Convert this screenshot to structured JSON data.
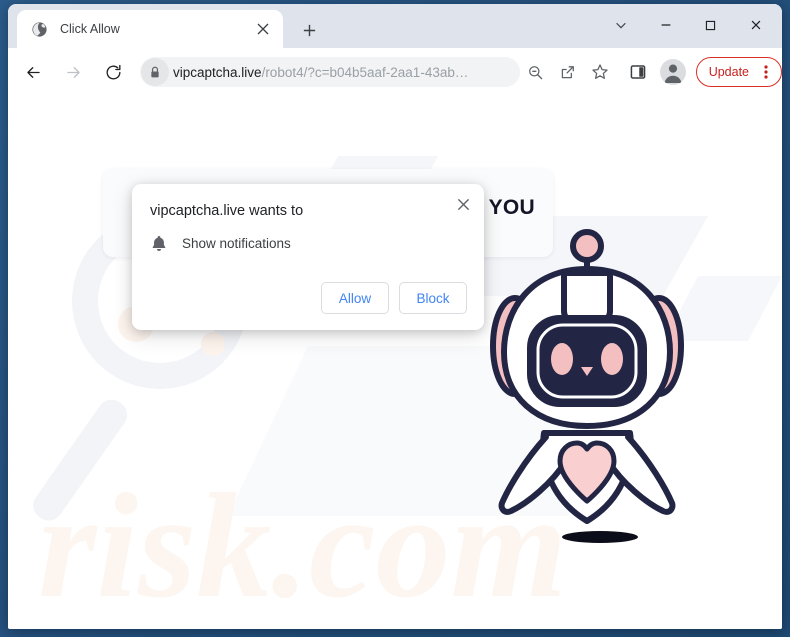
{
  "window": {
    "controls": {
      "tab_search": "tab-search-chevron",
      "minimize": "minimize",
      "maximize": "maximize",
      "close": "close"
    }
  },
  "tabstrip": {
    "tabs": [
      {
        "title": "Click Allow",
        "favicon": "globe-icon",
        "close": "close-icon"
      }
    ],
    "new_tab": "+"
  },
  "toolbar": {
    "back": "back-arrow-icon",
    "forward": "forward-arrow-icon",
    "reload": "reload-icon",
    "site_lock": "lock-icon",
    "url_prefix": "vipcaptcha.live",
    "url_suffix": "/robot4/?c=b04b5aaf-2aa1-43ab…",
    "url_full": "vipcaptcha.live/robot4/?c=b04b5aaf-2aa1-43ab…",
    "zoom_icon": "zoom-out-icon",
    "share_icon": "share-icon",
    "bookmark_icon": "star-icon",
    "side_panel_icon": "side-panel-icon",
    "profile_icon": "profile-avatar-icon",
    "update_label": "Update",
    "menu_icon": "three-dot-menu-icon"
  },
  "page": {
    "watermark": "PCrisk.com",
    "bubble_text": "YOU",
    "robot": "robot-mascot-illustration"
  },
  "dialog": {
    "title": "vipcaptcha.live wants to",
    "permission": "Show notifications",
    "permission_icon": "bell-icon",
    "close": "close-icon",
    "allow_label": "Allow",
    "block_label": "Block"
  },
  "colors": {
    "accent_blue": "#4285f4",
    "update_red": "#c5221f",
    "robot_navy": "#232544",
    "robot_pink": "#f6c6c6",
    "desktop_blue": "#255182"
  }
}
